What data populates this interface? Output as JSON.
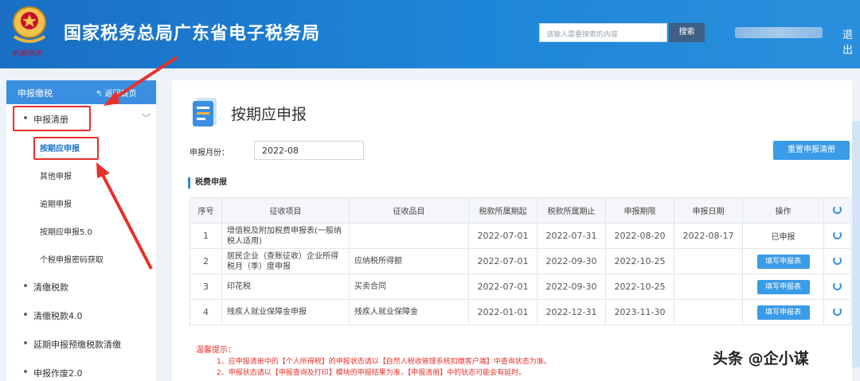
{
  "header": {
    "title": "国家税务总局广东省电子税务局",
    "brand_sub": "中国税务",
    "search_placeholder": "请输入需要搜索的内容",
    "search_button": "搜索",
    "logout": "退出"
  },
  "sidebar": {
    "header_title": "申报缴税",
    "home_link": "返回首页",
    "items": [
      {
        "label": "申报清册",
        "expanded": true
      },
      {
        "label": "清缴税款"
      },
      {
        "label": "清缴税款4.0"
      },
      {
        "label": "延期申报预缴税款清缴"
      },
      {
        "label": "申报作废2.0"
      }
    ],
    "sub_items": [
      {
        "label": "按期应申报",
        "active": true
      },
      {
        "label": "其他申报"
      },
      {
        "label": "逾期申报"
      },
      {
        "label": "按期应申报5.0"
      },
      {
        "label": "个税申报密码获取"
      }
    ]
  },
  "main": {
    "page_title": "按期应申报",
    "period_label": "申报月份：",
    "period_value": "2022-08",
    "reset_button": "重置申报清册",
    "section_title": "税费申报",
    "table": {
      "headers": [
        "序号",
        "征收项目",
        "征收品目",
        "税款所属期起",
        "税款所属期止",
        "申报期限",
        "申报日期",
        "操作"
      ],
      "rows": [
        {
          "no": "1",
          "item": "增值税及附加税费申报表(一般纳税人适用)",
          "subitem": "",
          "start": "2022-07-01",
          "end": "2022-07-31",
          "deadline": "2022-08-20",
          "date": "2022-08-17",
          "action": "已申报"
        },
        {
          "no": "2",
          "item": "居民企业（查账征收）企业所得税月（季）度申报",
          "subitem": "应纳税所得额",
          "start": "2022-07-01",
          "end": "2022-09-30",
          "deadline": "2022-10-25",
          "date": "",
          "action": "填写申报表"
        },
        {
          "no": "3",
          "item": "印花税",
          "subitem": "买卖合同",
          "start": "2022-07-01",
          "end": "2022-09-30",
          "deadline": "2022-10-25",
          "date": "",
          "action": "填写申报表"
        },
        {
          "no": "4",
          "item": "残疾人就业保障金申报",
          "subitem": "残疾人就业保障金",
          "start": "2022-01-01",
          "end": "2022-12-31",
          "deadline": "2023-11-30",
          "date": "",
          "action": "填写申报表"
        }
      ]
    },
    "notice": {
      "title": "温馨提示：",
      "lines": [
        "1、应申报清册中的【个人所得税】的申报状态请以【自然人税收管理系统扣缴客户端】中查询状态为准。",
        "2、申报状态请以【申报查询及打印】模块的申报结果为准，【申报清册】中的状态可能会有延时。"
      ]
    }
  },
  "watermark": "头条 @企小谋",
  "colors": {
    "header_blue": "#1e86d8",
    "accent": "#3a9be6",
    "highlight_red": "#e8302a",
    "notice_red": "#e8302a"
  }
}
